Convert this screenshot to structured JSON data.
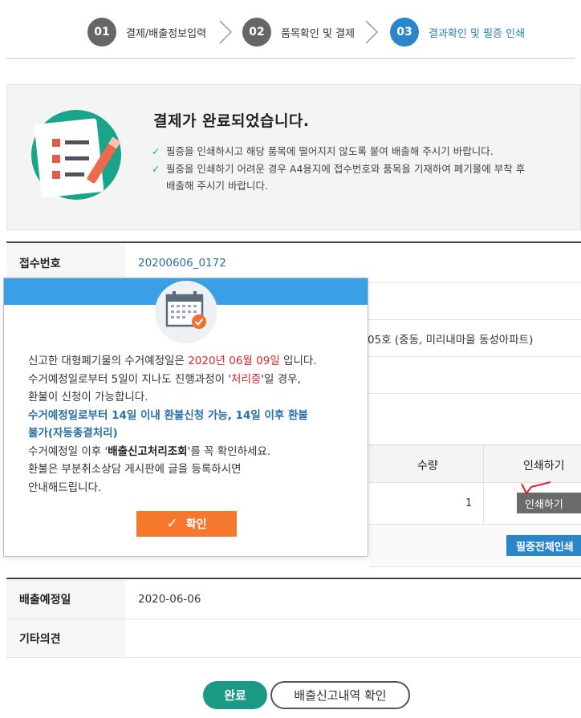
{
  "steps": [
    {
      "num": "01",
      "label": "결제/배출정보입력"
    },
    {
      "num": "02",
      "label": "품목확인 및 결제"
    },
    {
      "num": "03",
      "label": "결과확인 및 필증 인쇄"
    }
  ],
  "result": {
    "title": "결제가 완료되었습니다.",
    "item1": "필증을 인쇄하시고 해당 품목에 떨어지지 않도록 붙여 배출해 주시기 바랍니다.",
    "item2": "필증을 인쇄하기 어려운 경우 A4용지에 접수번호와 품목을 기재하여 폐기물에 부착 후",
    "item2b": "배출해 주시기 바랍니다."
  },
  "info": {
    "receipt_label": "접수번호",
    "receipt_value": "20200606_0172",
    "address_fragment": "05호 (중동, 미리내마을 동성아파트)"
  },
  "items": {
    "qty_header": "수량",
    "print_header": "인쇄하기",
    "qty_value": "1",
    "print_button": "인쇄하기",
    "print_all_button": "필증전체인쇄"
  },
  "bottom": {
    "date_label": "배출예정일",
    "date_value": "2020-06-06",
    "note_label": "기타의견",
    "note_value": ""
  },
  "buttons": {
    "done": "완료",
    "history": "배출신고내역 확인"
  },
  "modal": {
    "l1a": "신고한 대형폐기물의 수거예정일은 ",
    "l1date": "2020년 06월 09일",
    "l1b": " 입니다.",
    "l2a": "수거예정일로부터 5일이 지나도 진행과정이 '",
    "l2status": "처리중",
    "l2b": "'일 경우,",
    "l3": "환불이 신청이 가능합니다.",
    "l4": "수거예정일로부터 14일 이내 환불신청 가능, 14일 이후 환불",
    "l5": "불가(자동종결처리)",
    "l6a": "수거예정일 이후 '",
    "l6bold": "배출신고처리조회",
    "l6b": "'를 꼭 확인하세요.",
    "l7": "환불은 부분취소상담 게시판에 글을 등록하시면",
    "l8": "안내해드립니다.",
    "confirm": "확인"
  },
  "colors": {
    "accent_blue": "#2a86c9",
    "modal_bar": "#3aa0e6",
    "confirm_orange": "#f5782d",
    "done_green": "#1a9a82",
    "date_red": "#d8262e"
  }
}
